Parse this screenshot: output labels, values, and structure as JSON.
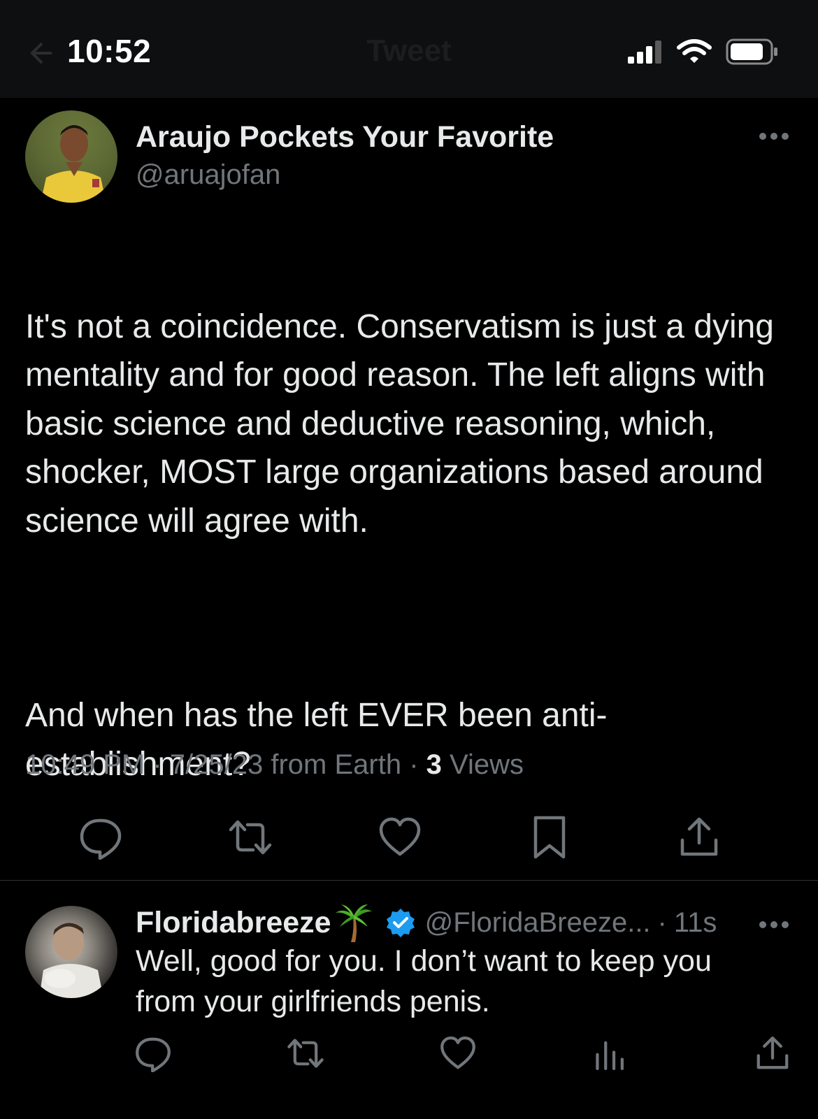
{
  "status_bar": {
    "time": "10:52"
  },
  "nav": {
    "title": "Tweet"
  },
  "tweet": {
    "author_name": "Araujo Pockets Your Favorite",
    "author_handle": "@aruajofan",
    "paragraph_1": "It's not a coincidence. Conservatism is just a dying mentality and for good reason. The left aligns with basic science and deductive reasoning, which, shocker, MOST large organizations based around science will agree with.",
    "paragraph_2": "And when has the left EVER been anti-establishment?",
    "time": "10:49 PM",
    "date": "7/25/23",
    "source": "from Earth",
    "views_count": "3",
    "views_label": "Views"
  },
  "reply": {
    "author_name": "Floridabreeze",
    "author_emoji": "palm-tree",
    "author_handle": "@FloridaBreeze...",
    "time": "11s",
    "text": "Well, good for you. I don’t want to keep you from your girlfriends penis."
  },
  "colors": {
    "background": "#000000",
    "text_primary": "#e7e9ea",
    "text_secondary": "#71767b",
    "verified_blue": "#1d9bf0",
    "divider": "#2f3336"
  }
}
